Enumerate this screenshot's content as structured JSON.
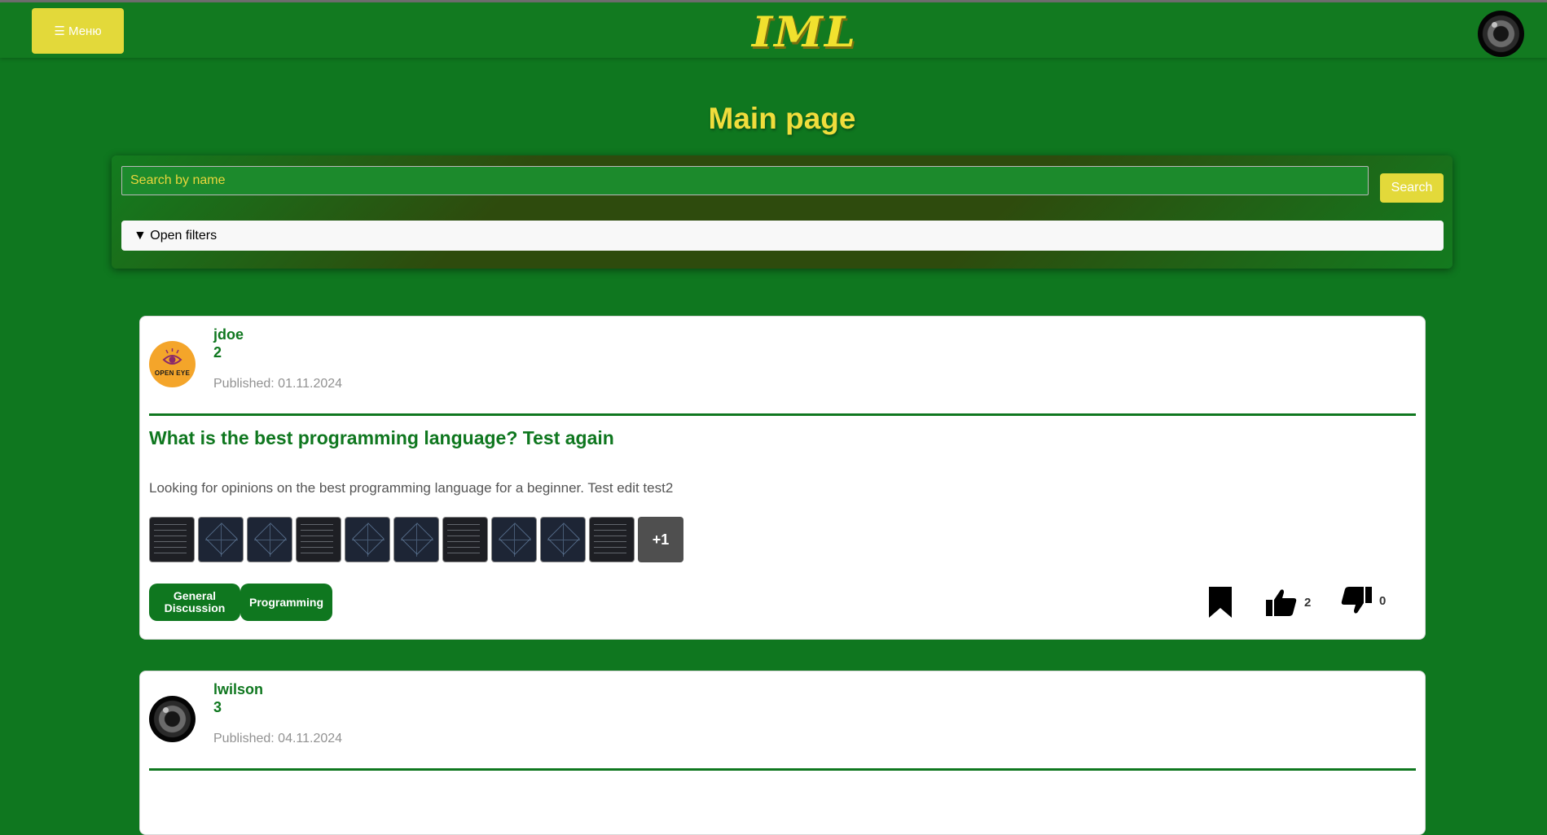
{
  "navbar": {
    "menu_label": "☰ Меню",
    "logo_text": "IML"
  },
  "page": {
    "title": "Main page"
  },
  "search": {
    "placeholder": "Search by name",
    "button_label": "Search",
    "filters_label": "▼ Open filters"
  },
  "posts": [
    {
      "author": "jdoe",
      "rating": "2",
      "avatar_text": "OPEN EYE",
      "published": "Published: 01.11.2024",
      "title": "What is the best programming language? Test again",
      "body": "Looking for opinions on the best programming language for a beginner. Test edit test2",
      "more_images": "+1",
      "tags": [
        "General Discussion",
        "Programming"
      ],
      "likes": "2",
      "dislikes": "0"
    },
    {
      "author": "lwilson",
      "rating": "3",
      "published": "Published: 04.11.2024"
    }
  ],
  "colors": {
    "background": "#0f771f",
    "accent_yellow": "#e3d93a",
    "title_yellow": "#f0dd3c"
  }
}
